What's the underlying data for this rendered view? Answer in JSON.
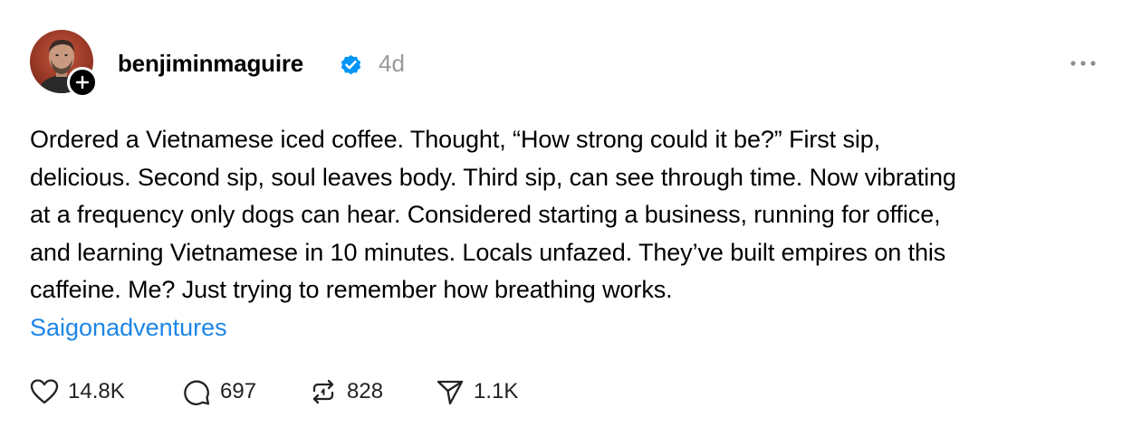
{
  "post": {
    "author": {
      "username": "benjiminmaguire",
      "verified": true,
      "avatar_icon": "profile-photo"
    },
    "timestamp": "4d",
    "text": "Ordered a Vietnamese iced coffee. Thought, “How strong could it be?” First sip,\ndelicious. Second sip, soul leaves body. Third sip, can see through time. Now vibrating\nat a frequency only dogs can hear. Considered starting a business, running for office,\nand learning Vietnamese in 10 minutes. Locals unfazed. They’ve built empires on this\ncaffeine. Me? Just trying to remember how breathing works.",
    "tag": "Saigonadventures",
    "actions": {
      "likes": "14.8K",
      "replies": "697",
      "reposts": "828",
      "shares": "1.1K"
    }
  },
  "colors": {
    "verified_blue": "#0095f6",
    "tag_blue": "#1d86e8",
    "timestamp_gray": "#999999"
  },
  "icons": {
    "follow": "plus-icon",
    "verified": "verified-badge-icon",
    "more": "more-horizontal-icon",
    "like": "heart-icon",
    "reply": "comment-icon",
    "repost": "repost-icon",
    "share": "send-icon"
  }
}
